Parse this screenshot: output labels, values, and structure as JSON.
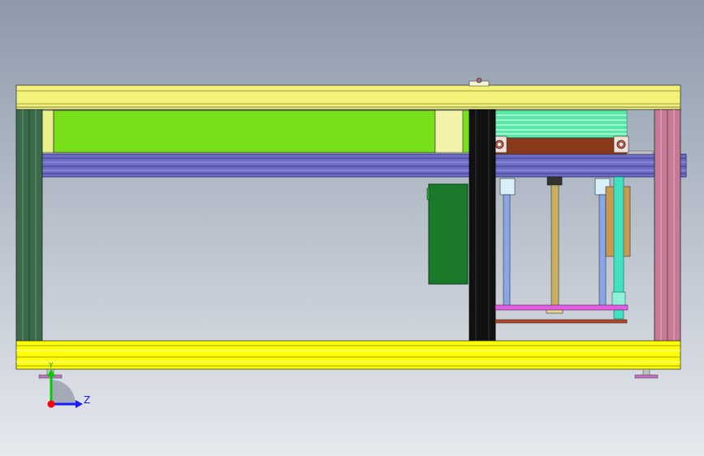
{
  "viewport": {
    "background_top": "#8d9aab",
    "background_bottom": "#e6e9ee"
  },
  "triad": {
    "label_z": "Z",
    "label_y": "Y",
    "color_z": "#1a1aff",
    "color_y": "#00cc00",
    "color_origin": "#ff0000"
  },
  "colors": {
    "frame_yellow": "#f2f27a",
    "frame_yellow_dark": "#c8c818",
    "frame_bright_yellow": "#ffff00",
    "lime_panel": "#77e01a",
    "rail_blue": "#7070c8",
    "dark_green_post": "#3a6a4a",
    "pink_post": "#c77a96",
    "black_column": "#111111",
    "green_box": "#1a7a2a",
    "mint_block": "#5ae8a8",
    "brown_plate": "#8a3a1a",
    "magenta_plate": "#e060e0",
    "steel_rod": "#8aa6e6",
    "brass_rod": "#c8b060",
    "teal_rod": "#40e0c0"
  }
}
